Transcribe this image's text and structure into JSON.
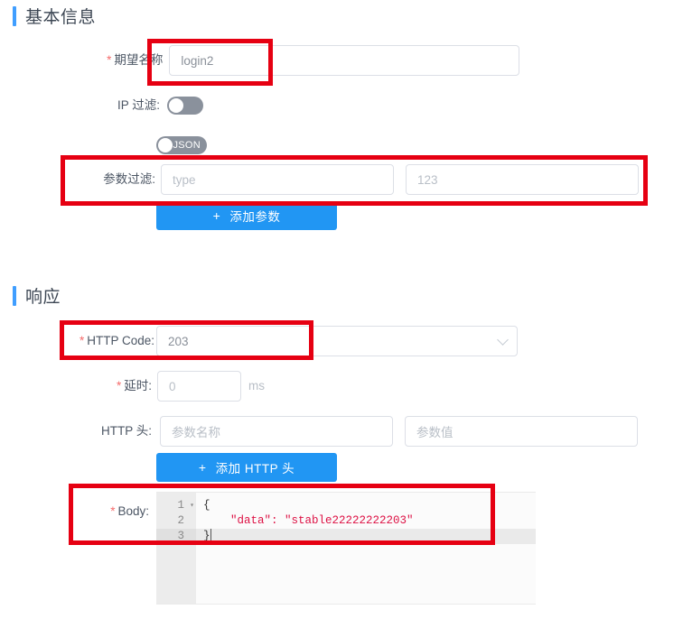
{
  "sections": {
    "basic": {
      "title": "基本信息"
    },
    "response": {
      "title": "响应"
    }
  },
  "basic_form": {
    "expect_name": {
      "label": "期望名称",
      "required_mark": "*",
      "value": "login2"
    },
    "ip_filter": {
      "label": "IP 过滤:",
      "state": "off"
    },
    "json_toggle": {
      "label": "JSON",
      "state": "off"
    },
    "param_filter": {
      "label": "参数过滤:",
      "name_value": "type",
      "value_value": "123"
    },
    "add_param_button": {
      "icon": "plus-icon",
      "label": "添加参数"
    }
  },
  "response_form": {
    "http_code": {
      "label": "HTTP Code:",
      "required_mark": "*",
      "value": "203",
      "dropdown_icon": "chevron-down-icon"
    },
    "delay": {
      "label": "延时:",
      "required_mark": "*",
      "value": "0",
      "unit": "ms"
    },
    "http_header": {
      "label": "HTTP 头:",
      "name_placeholder": "参数名称",
      "value_placeholder": "参数值"
    },
    "add_header_button": {
      "icon": "plus-icon",
      "label": "添加 HTTP 头"
    },
    "body": {
      "label": "Body:",
      "required_mark": "*",
      "line_numbers": [
        "1",
        "2",
        "3"
      ],
      "lines": [
        "{",
        "    \"data\": \"stable22222222203\"",
        "}"
      ],
      "fold_marker": "▾"
    }
  },
  "colors": {
    "accent_blue": "#409eff",
    "button_blue": "#2196f3",
    "required_red": "#f56c6c",
    "annotation_red": "#e60012",
    "switch_off": "#8a919c"
  },
  "annotations": [
    {
      "name": "expect-name-highlight"
    },
    {
      "name": "param-filter-highlight"
    },
    {
      "name": "http-code-highlight"
    },
    {
      "name": "body-highlight"
    }
  ]
}
